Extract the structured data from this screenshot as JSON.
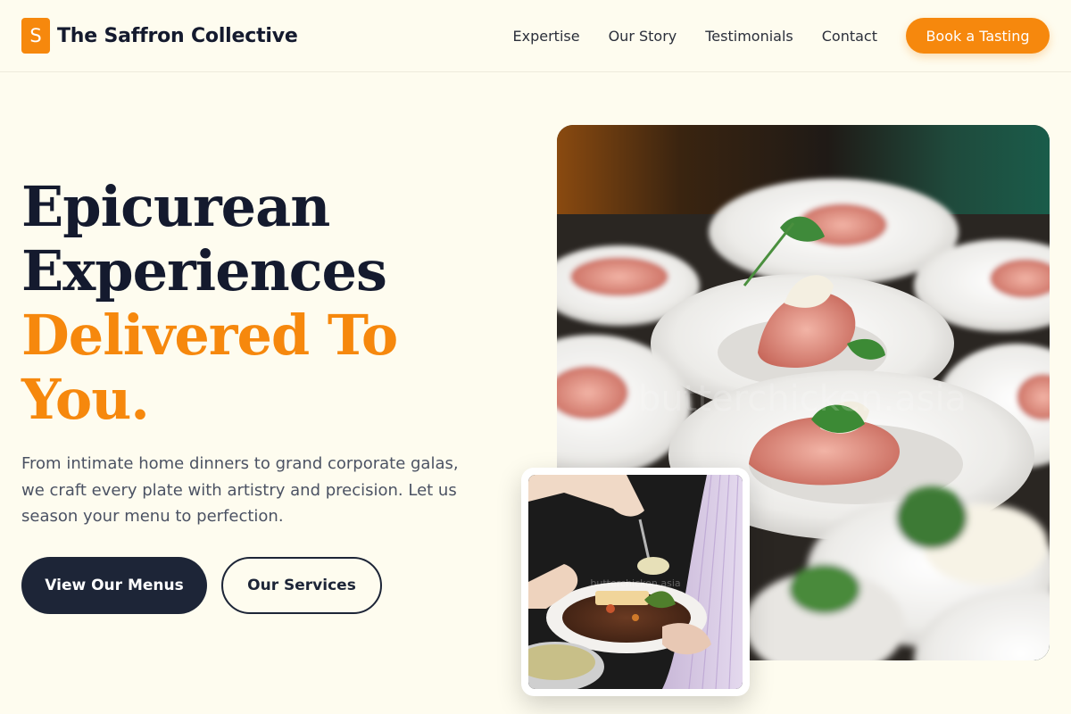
{
  "brand": {
    "logo_letter": "S",
    "name": "The Saffron Collective"
  },
  "nav": {
    "links": [
      "Expertise",
      "Our Story",
      "Testimonials",
      "Contact"
    ],
    "cta_label": "Book a Tasting"
  },
  "hero": {
    "title_lines": [
      "Epicurean",
      "Experiences",
      "Delivered To",
      "You."
    ],
    "description": "From intimate home dinners to grand corporate galas, we craft every plate with artistry and precision. Let us season your menu to perfection.",
    "primary_button": "View Our Menus",
    "secondary_button": "Our Services"
  },
  "images": {
    "main_watermark": "butterchicken.asia",
    "card_watermark": "butterchicken.asia"
  },
  "colors": {
    "background": "#fefcef",
    "accent": "#f6880d",
    "navy": "#1d2537",
    "heading": "#141a2e",
    "body_text": "#4b5263"
  }
}
